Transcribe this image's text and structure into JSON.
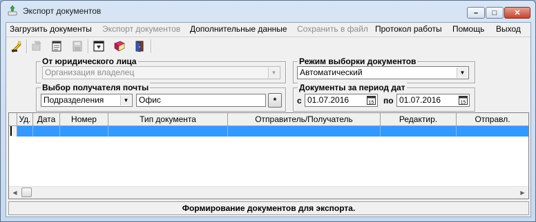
{
  "window": {
    "title": "Экспорт документов",
    "minimize_label": "–",
    "maximize_label": "□",
    "close_label": "✕"
  },
  "menu": [
    {
      "label": "Загрузить документы",
      "enabled": true
    },
    {
      "label": "Экспорт документов",
      "enabled": false
    },
    {
      "label": "Дополнительные данные",
      "enabled": true
    },
    {
      "label": "Сохранить в файл",
      "enabled": false
    },
    {
      "label": "Протокол работы",
      "enabled": true
    },
    {
      "label": "Помощь",
      "enabled": true
    },
    {
      "label": "Выход",
      "enabled": true
    }
  ],
  "toolbar": {
    "icons": [
      "load-icon",
      "export-icon",
      "notes-icon",
      "save-icon",
      "protocol-icon",
      "help-book-icon",
      "exit-door-icon"
    ]
  },
  "legal_entity": {
    "label": "От юридического лица",
    "value": "Организация владелец",
    "enabled": false
  },
  "mail_recipient": {
    "label": "Выбор получателя почты",
    "type_value": "Подразделения",
    "recipient_value": "Офис",
    "pick_button_label": "*"
  },
  "selection_mode": {
    "label": "Режим выборки документов",
    "value": "Автоматический"
  },
  "date_period": {
    "label": "Документы за период дат",
    "from_label": "с",
    "from_value": "01.07.2016",
    "to_label": "по",
    "to_value": "01.07.2016",
    "calendar_glyph": "15"
  },
  "grid": {
    "columns": [
      "Уд.",
      "Дата",
      "Номер",
      "Тип документа",
      "Отправитель/Получатель",
      "Редактир.",
      "Отправл."
    ],
    "rows": [
      [
        "",
        "",
        "",
        "",
        "",
        "",
        ""
      ]
    ]
  },
  "status": {
    "text": "Формирование документов для экспорта."
  }
}
